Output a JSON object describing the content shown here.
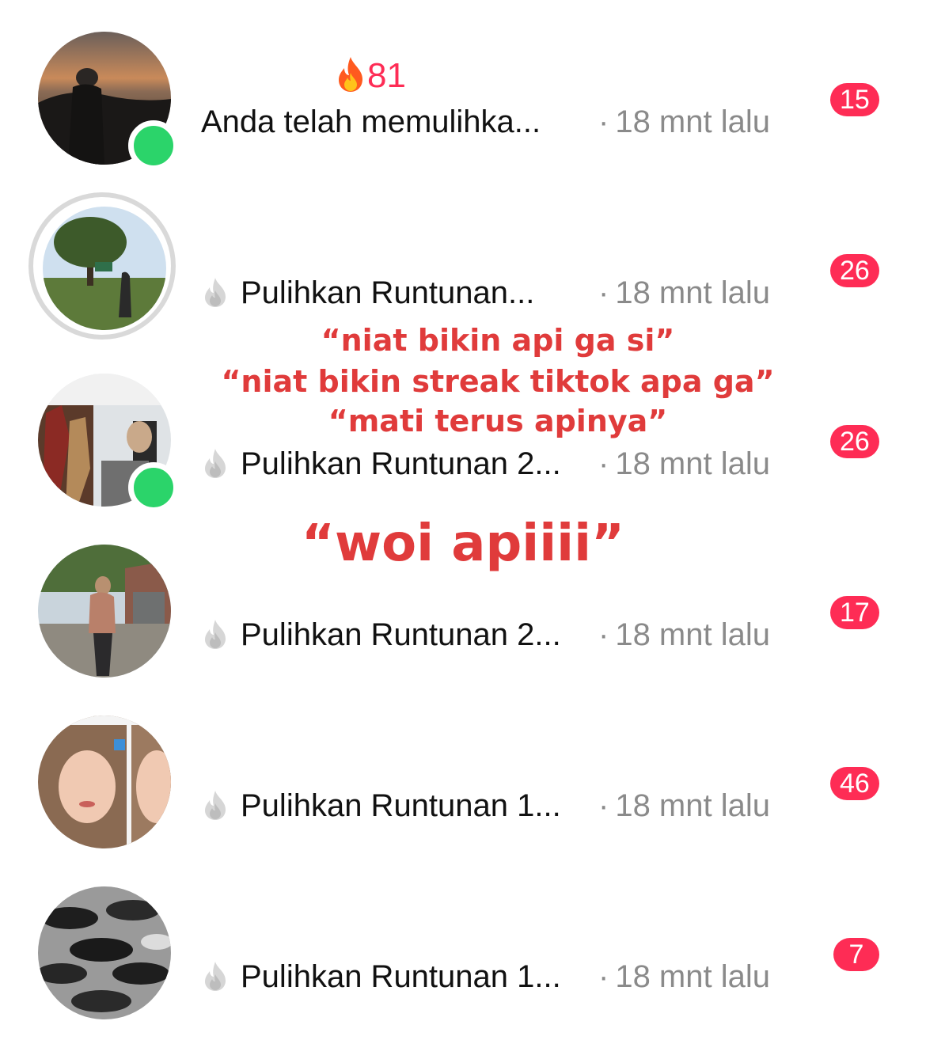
{
  "colors": {
    "accent": "#fe2c55",
    "online": "#2bd46a",
    "overlay_text": "#e03b3b",
    "muted": "#8a8a8a"
  },
  "chats": [
    {
      "streak_count": "81",
      "preview": "Anda telah memulihka...",
      "time": "18 mnt lalu",
      "unread": "15",
      "online": true
    },
    {
      "preview": "Pulihkan Runtunan...",
      "time": "18 mnt lalu",
      "unread": "26",
      "online": false,
      "story_ring": true
    },
    {
      "preview": "Pulihkan Runtunan 2...",
      "time": "18 mnt lalu",
      "unread": "26",
      "online": true
    },
    {
      "preview": "Pulihkan Runtunan 2...",
      "time": "18 mnt lalu",
      "unread": "17",
      "online": false
    },
    {
      "preview": "Pulihkan Runtunan 1...",
      "time": "18 mnt lalu",
      "unread": "46",
      "online": false
    },
    {
      "preview": "Pulihkan Runtunan 1...",
      "time": "18 mnt lalu",
      "unread": "7",
      "online": false
    }
  ],
  "separator": "·",
  "overlay": {
    "line1": "“niat bikin api ga si”",
    "line2": "“niat bikin streak tiktok apa ga”",
    "line3": "“mati terus apinya”",
    "line4": "“woi apiiii”"
  }
}
